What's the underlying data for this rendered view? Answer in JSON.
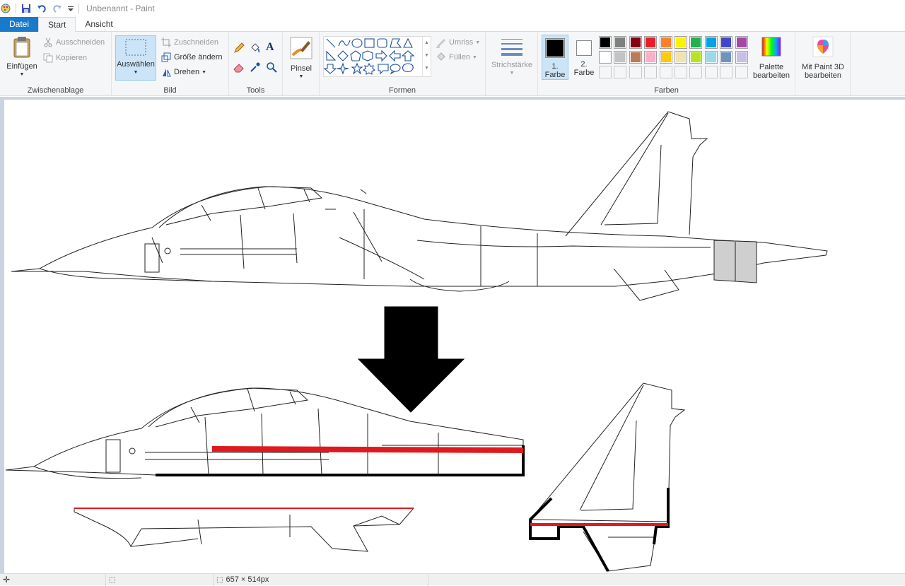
{
  "window": {
    "title": "Unbenannt - Paint"
  },
  "quick_access": {
    "icons": [
      "paint-app-icon",
      "save-icon",
      "undo-icon",
      "redo-icon",
      "customize-dropdown-icon"
    ]
  },
  "tabs": [
    {
      "label": "Datei"
    },
    {
      "label": "Start"
    },
    {
      "label": "Ansicht"
    }
  ],
  "ribbon": {
    "clipboard": {
      "label": "Zwischenablage",
      "paste": "Einfügen",
      "cut": "Ausschneiden",
      "copy": "Kopieren"
    },
    "image": {
      "label": "Bild",
      "select": "Auswählen",
      "crop": "Zuschneiden",
      "resize": "Größe ändern",
      "rotate": "Drehen"
    },
    "tools": {
      "label": "Tools"
    },
    "brushes": {
      "label": "Pinsel"
    },
    "shapes": {
      "label": "Formen",
      "outline": "Umriss",
      "fill": "Füllen"
    },
    "size": {
      "label": "Strichstärke"
    },
    "colors": {
      "label": "Farben",
      "color1_line1": "1.",
      "color1_line2": "Farbe",
      "color2_line1": "2.",
      "color2_line2": "Farbe",
      "edit_line1": "Palette",
      "edit_line2": "bearbeiten",
      "color1": "#000000",
      "color2": "#ffffff",
      "palette_row1": [
        "#000000",
        "#7f7f7f",
        "#880015",
        "#ed1c24",
        "#ff7f27",
        "#fff200",
        "#22b14c",
        "#00a2e8",
        "#3f48cc",
        "#a349a4"
      ],
      "palette_row2": [
        "#ffffff",
        "#c3c3c3",
        "#b97a57",
        "#ffaec9",
        "#ffc90e",
        "#efe4b0",
        "#b5e61d",
        "#99d9ea",
        "#7092be",
        "#c8bfe7"
      ]
    },
    "paint3d": {
      "line1": "Mit Paint 3D",
      "line2": "bearbeiten"
    }
  },
  "status": {
    "selection_size": "657 × 514px"
  }
}
